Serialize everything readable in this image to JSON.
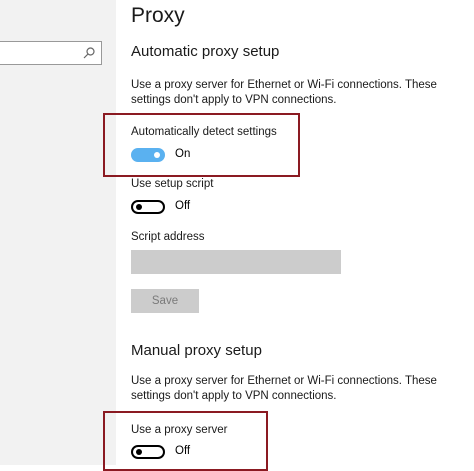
{
  "page": {
    "title": "Proxy"
  },
  "sidebar": {
    "search": {
      "value": ""
    }
  },
  "auto": {
    "title": "Automatic proxy setup",
    "description": "Use a proxy server for Ethernet or Wi-Fi connections. These settings don't apply to VPN connections.",
    "detect": {
      "label": "Automatically detect settings",
      "state": "On"
    },
    "script": {
      "label": "Use setup script",
      "state": "Off"
    },
    "address": {
      "label": "Script address",
      "value": ""
    },
    "save_label": "Save"
  },
  "manual": {
    "title": "Manual proxy setup",
    "description": "Use a proxy server for Ethernet or Wi-Fi connections. These settings don't apply to VPN connections.",
    "use_proxy": {
      "label": "Use a proxy server",
      "state": "Off"
    }
  },
  "colors": {
    "toggle_on": "#5ab1f0",
    "highlight": "#8b1a22",
    "disabled": "#cccccc"
  },
  "icons": {
    "search": "search-icon"
  }
}
